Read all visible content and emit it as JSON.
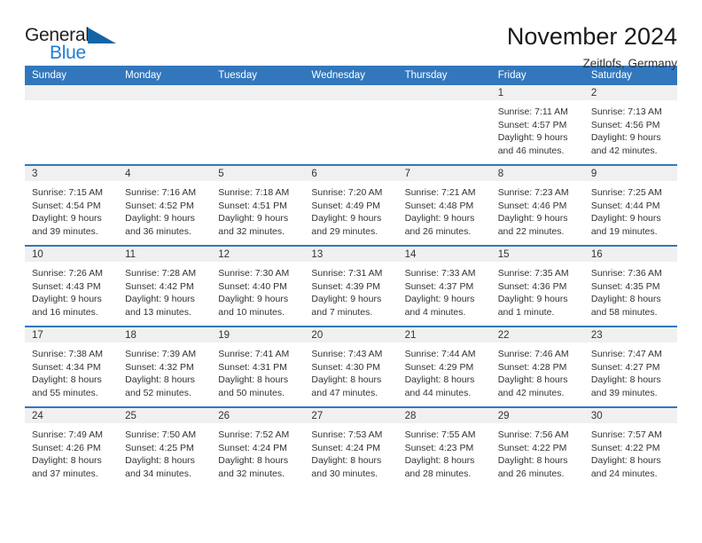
{
  "brand": {
    "word_one": "General",
    "word_two": "Blue",
    "logo_icon": "triangle-logo-icon",
    "accent_color": "#1464a5",
    "blue_text_color": "#1c7fd4"
  },
  "header": {
    "title": "November 2024",
    "location": "Zeitlofs, Germany"
  },
  "theme": {
    "header_blue": "#3277bc",
    "daynum_band": "#f0f0f0",
    "text": "#333333"
  },
  "calendar": {
    "weekday_headers": [
      "Sunday",
      "Monday",
      "Tuesday",
      "Wednesday",
      "Thursday",
      "Friday",
      "Saturday"
    ],
    "weeks": [
      [
        {
          "day": "",
          "sunrise": "",
          "sunset": "",
          "daylight": "",
          "daylight_cont": ""
        },
        {
          "day": "",
          "sunrise": "",
          "sunset": "",
          "daylight": "",
          "daylight_cont": ""
        },
        {
          "day": "",
          "sunrise": "",
          "sunset": "",
          "daylight": "",
          "daylight_cont": ""
        },
        {
          "day": "",
          "sunrise": "",
          "sunset": "",
          "daylight": "",
          "daylight_cont": ""
        },
        {
          "day": "",
          "sunrise": "",
          "sunset": "",
          "daylight": "",
          "daylight_cont": ""
        },
        {
          "day": "1",
          "sunrise": "Sunrise: 7:11 AM",
          "sunset": "Sunset: 4:57 PM",
          "daylight": "Daylight: 9 hours",
          "daylight_cont": "and 46 minutes."
        },
        {
          "day": "2",
          "sunrise": "Sunrise: 7:13 AM",
          "sunset": "Sunset: 4:56 PM",
          "daylight": "Daylight: 9 hours",
          "daylight_cont": "and 42 minutes."
        }
      ],
      [
        {
          "day": "3",
          "sunrise": "Sunrise: 7:15 AM",
          "sunset": "Sunset: 4:54 PM",
          "daylight": "Daylight: 9 hours",
          "daylight_cont": "and 39 minutes."
        },
        {
          "day": "4",
          "sunrise": "Sunrise: 7:16 AM",
          "sunset": "Sunset: 4:52 PM",
          "daylight": "Daylight: 9 hours",
          "daylight_cont": "and 36 minutes."
        },
        {
          "day": "5",
          "sunrise": "Sunrise: 7:18 AM",
          "sunset": "Sunset: 4:51 PM",
          "daylight": "Daylight: 9 hours",
          "daylight_cont": "and 32 minutes."
        },
        {
          "day": "6",
          "sunrise": "Sunrise: 7:20 AM",
          "sunset": "Sunset: 4:49 PM",
          "daylight": "Daylight: 9 hours",
          "daylight_cont": "and 29 minutes."
        },
        {
          "day": "7",
          "sunrise": "Sunrise: 7:21 AM",
          "sunset": "Sunset: 4:48 PM",
          "daylight": "Daylight: 9 hours",
          "daylight_cont": "and 26 minutes."
        },
        {
          "day": "8",
          "sunrise": "Sunrise: 7:23 AM",
          "sunset": "Sunset: 4:46 PM",
          "daylight": "Daylight: 9 hours",
          "daylight_cont": "and 22 minutes."
        },
        {
          "day": "9",
          "sunrise": "Sunrise: 7:25 AM",
          "sunset": "Sunset: 4:44 PM",
          "daylight": "Daylight: 9 hours",
          "daylight_cont": "and 19 minutes."
        }
      ],
      [
        {
          "day": "10",
          "sunrise": "Sunrise: 7:26 AM",
          "sunset": "Sunset: 4:43 PM",
          "daylight": "Daylight: 9 hours",
          "daylight_cont": "and 16 minutes."
        },
        {
          "day": "11",
          "sunrise": "Sunrise: 7:28 AM",
          "sunset": "Sunset: 4:42 PM",
          "daylight": "Daylight: 9 hours",
          "daylight_cont": "and 13 minutes."
        },
        {
          "day": "12",
          "sunrise": "Sunrise: 7:30 AM",
          "sunset": "Sunset: 4:40 PM",
          "daylight": "Daylight: 9 hours",
          "daylight_cont": "and 10 minutes."
        },
        {
          "day": "13",
          "sunrise": "Sunrise: 7:31 AM",
          "sunset": "Sunset: 4:39 PM",
          "daylight": "Daylight: 9 hours",
          "daylight_cont": "and 7 minutes."
        },
        {
          "day": "14",
          "sunrise": "Sunrise: 7:33 AM",
          "sunset": "Sunset: 4:37 PM",
          "daylight": "Daylight: 9 hours",
          "daylight_cont": "and 4 minutes."
        },
        {
          "day": "15",
          "sunrise": "Sunrise: 7:35 AM",
          "sunset": "Sunset: 4:36 PM",
          "daylight": "Daylight: 9 hours",
          "daylight_cont": "and 1 minute."
        },
        {
          "day": "16",
          "sunrise": "Sunrise: 7:36 AM",
          "sunset": "Sunset: 4:35 PM",
          "daylight": "Daylight: 8 hours",
          "daylight_cont": "and 58 minutes."
        }
      ],
      [
        {
          "day": "17",
          "sunrise": "Sunrise: 7:38 AM",
          "sunset": "Sunset: 4:34 PM",
          "daylight": "Daylight: 8 hours",
          "daylight_cont": "and 55 minutes."
        },
        {
          "day": "18",
          "sunrise": "Sunrise: 7:39 AM",
          "sunset": "Sunset: 4:32 PM",
          "daylight": "Daylight: 8 hours",
          "daylight_cont": "and 52 minutes."
        },
        {
          "day": "19",
          "sunrise": "Sunrise: 7:41 AM",
          "sunset": "Sunset: 4:31 PM",
          "daylight": "Daylight: 8 hours",
          "daylight_cont": "and 50 minutes."
        },
        {
          "day": "20",
          "sunrise": "Sunrise: 7:43 AM",
          "sunset": "Sunset: 4:30 PM",
          "daylight": "Daylight: 8 hours",
          "daylight_cont": "and 47 minutes."
        },
        {
          "day": "21",
          "sunrise": "Sunrise: 7:44 AM",
          "sunset": "Sunset: 4:29 PM",
          "daylight": "Daylight: 8 hours",
          "daylight_cont": "and 44 minutes."
        },
        {
          "day": "22",
          "sunrise": "Sunrise: 7:46 AM",
          "sunset": "Sunset: 4:28 PM",
          "daylight": "Daylight: 8 hours",
          "daylight_cont": "and 42 minutes."
        },
        {
          "day": "23",
          "sunrise": "Sunrise: 7:47 AM",
          "sunset": "Sunset: 4:27 PM",
          "daylight": "Daylight: 8 hours",
          "daylight_cont": "and 39 minutes."
        }
      ],
      [
        {
          "day": "24",
          "sunrise": "Sunrise: 7:49 AM",
          "sunset": "Sunset: 4:26 PM",
          "daylight": "Daylight: 8 hours",
          "daylight_cont": "and 37 minutes."
        },
        {
          "day": "25",
          "sunrise": "Sunrise: 7:50 AM",
          "sunset": "Sunset: 4:25 PM",
          "daylight": "Daylight: 8 hours",
          "daylight_cont": "and 34 minutes."
        },
        {
          "day": "26",
          "sunrise": "Sunrise: 7:52 AM",
          "sunset": "Sunset: 4:24 PM",
          "daylight": "Daylight: 8 hours",
          "daylight_cont": "and 32 minutes."
        },
        {
          "day": "27",
          "sunrise": "Sunrise: 7:53 AM",
          "sunset": "Sunset: 4:24 PM",
          "daylight": "Daylight: 8 hours",
          "daylight_cont": "and 30 minutes."
        },
        {
          "day": "28",
          "sunrise": "Sunrise: 7:55 AM",
          "sunset": "Sunset: 4:23 PM",
          "daylight": "Daylight: 8 hours",
          "daylight_cont": "and 28 minutes."
        },
        {
          "day": "29",
          "sunrise": "Sunrise: 7:56 AM",
          "sunset": "Sunset: 4:22 PM",
          "daylight": "Daylight: 8 hours",
          "daylight_cont": "and 26 minutes."
        },
        {
          "day": "30",
          "sunrise": "Sunrise: 7:57 AM",
          "sunset": "Sunset: 4:22 PM",
          "daylight": "Daylight: 8 hours",
          "daylight_cont": "and 24 minutes."
        }
      ]
    ]
  }
}
